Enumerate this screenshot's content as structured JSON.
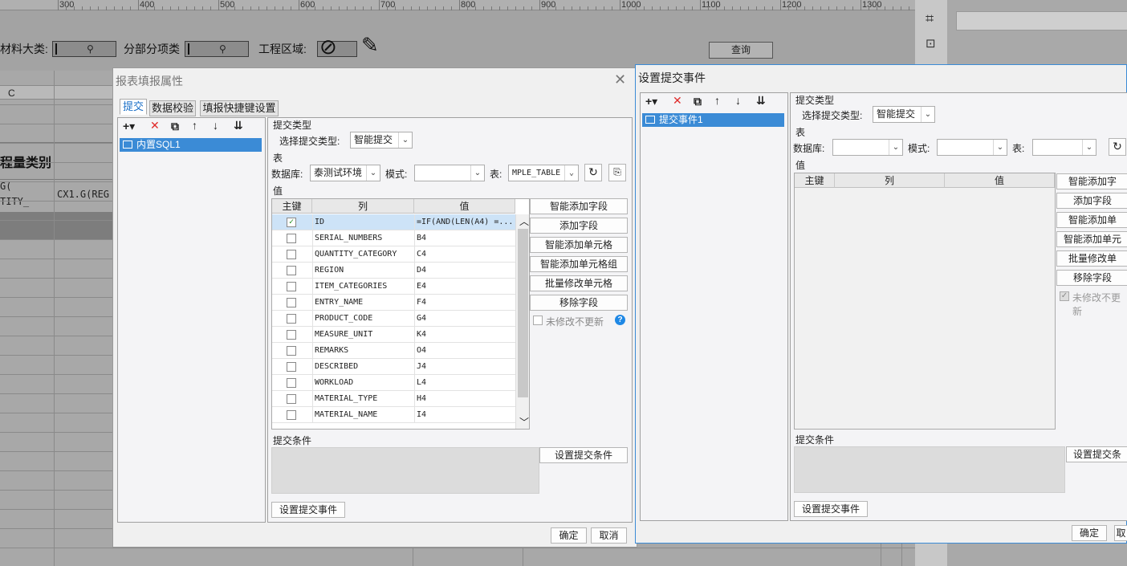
{
  "ruler": {
    "ticks": [
      "300",
      "400",
      "500",
      "600",
      "700",
      "800",
      "900",
      "1000",
      "1100",
      "1200",
      "1300"
    ]
  },
  "params": {
    "material_label": "材料大类:",
    "subitem_label": "分部分项类",
    "area_label": "工程区域:",
    "query_button": "查询"
  },
  "grid": {
    "col_header": "C",
    "header_cell": "程量类别",
    "cell_a_line1": "G(",
    "cell_a_line2": "TITY_",
    "cell_b": "CX1.G(REG"
  },
  "dialog1": {
    "title": "报表填报属性",
    "tabs": [
      "提交",
      "数据校验",
      "填报快捷键设置"
    ],
    "tree_item": "内置SQL1",
    "submit_type_section": "提交类型",
    "select_type_label": "选择提交类型:",
    "select_type_value": "智能提交",
    "table_section": "表",
    "db_label": "数据库:",
    "db_value": "泰测试环境",
    "schema_label": "模式:",
    "schema_value": "",
    "table_label": "表:",
    "table_value": "MPLE_TABLE",
    "value_section": "值",
    "columns": [
      "主键",
      "列",
      "值"
    ],
    "rows": [
      {
        "key": true,
        "col": "ID",
        "val": "=IF(AND(LEN(A4) =..."
      },
      {
        "key": false,
        "col": "SERIAL_NUMBERS",
        "val": "B4"
      },
      {
        "key": false,
        "col": "QUANTITY_CATEGORY",
        "val": "C4"
      },
      {
        "key": false,
        "col": "REGION",
        "val": "D4"
      },
      {
        "key": false,
        "col": "ITEM_CATEGORIES",
        "val": "E4"
      },
      {
        "key": false,
        "col": "ENTRY_NAME",
        "val": "F4"
      },
      {
        "key": false,
        "col": "PRODUCT_CODE",
        "val": "G4"
      },
      {
        "key": false,
        "col": "MEASURE_UNIT",
        "val": "K4"
      },
      {
        "key": false,
        "col": "REMARKS",
        "val": "O4"
      },
      {
        "key": false,
        "col": "DESCRIBED",
        "val": "J4"
      },
      {
        "key": false,
        "col": "WORKLOAD",
        "val": "L4"
      },
      {
        "key": false,
        "col": "MATERIAL_TYPE",
        "val": "H4"
      },
      {
        "key": false,
        "col": "MATERIAL_NAME",
        "val": "I4"
      }
    ],
    "buttons": [
      "智能添加字段",
      "添加字段",
      "智能添加单元格",
      "智能添加单元格组",
      "批量修改单元格",
      "移除字段"
    ],
    "no_update_checkbox": "未修改不更新",
    "condition_section": "提交条件",
    "set_condition_button": "设置提交条件",
    "set_event_button": "设置提交事件",
    "ok_button": "确定",
    "cancel_button": "取消"
  },
  "dialog2": {
    "title": "设置提交事件",
    "tree_item": "提交事件1",
    "submit_type_section": "提交类型",
    "select_type_label": "选择提交类型:",
    "select_type_value": "智能提交",
    "table_section": "表",
    "db_label": "数据库:",
    "schema_label": "模式:",
    "table_label": "表:",
    "value_section": "值",
    "columns": [
      "主键",
      "列",
      "值"
    ],
    "buttons": [
      "智能添加字",
      "添加字段",
      "智能添加单",
      "智能添加单元",
      "批量修改单",
      "移除字段"
    ],
    "no_update_checkbox": "未修改不更新",
    "condition_section": "提交条件",
    "set_condition_button": "设置提交条",
    "set_event_button": "设置提交事件",
    "ok_button": "确定",
    "cancel_button": "取"
  }
}
